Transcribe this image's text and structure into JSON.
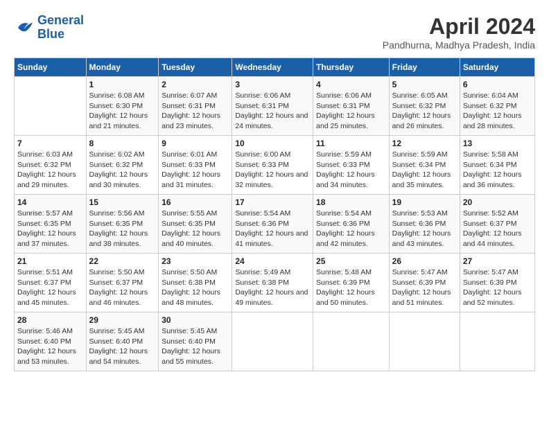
{
  "logo": {
    "line1": "General",
    "line2": "Blue"
  },
  "title": "April 2024",
  "location": "Pandhurna, Madhya Pradesh, India",
  "days_header": [
    "Sunday",
    "Monday",
    "Tuesday",
    "Wednesday",
    "Thursday",
    "Friday",
    "Saturday"
  ],
  "weeks": [
    [
      {
        "day": "",
        "sunrise": "",
        "sunset": "",
        "daylight": ""
      },
      {
        "day": "1",
        "sunrise": "6:08 AM",
        "sunset": "6:30 PM",
        "daylight": "12 hours and 21 minutes."
      },
      {
        "day": "2",
        "sunrise": "6:07 AM",
        "sunset": "6:31 PM",
        "daylight": "12 hours and 23 minutes."
      },
      {
        "day": "3",
        "sunrise": "6:06 AM",
        "sunset": "6:31 PM",
        "daylight": "12 hours and 24 minutes."
      },
      {
        "day": "4",
        "sunrise": "6:06 AM",
        "sunset": "6:31 PM",
        "daylight": "12 hours and 25 minutes."
      },
      {
        "day": "5",
        "sunrise": "6:05 AM",
        "sunset": "6:32 PM",
        "daylight": "12 hours and 26 minutes."
      },
      {
        "day": "6",
        "sunrise": "6:04 AM",
        "sunset": "6:32 PM",
        "daylight": "12 hours and 28 minutes."
      }
    ],
    [
      {
        "day": "7",
        "sunrise": "6:03 AM",
        "sunset": "6:32 PM",
        "daylight": "12 hours and 29 minutes."
      },
      {
        "day": "8",
        "sunrise": "6:02 AM",
        "sunset": "6:32 PM",
        "daylight": "12 hours and 30 minutes."
      },
      {
        "day": "9",
        "sunrise": "6:01 AM",
        "sunset": "6:33 PM",
        "daylight": "12 hours and 31 minutes."
      },
      {
        "day": "10",
        "sunrise": "6:00 AM",
        "sunset": "6:33 PM",
        "daylight": "12 hours and 32 minutes."
      },
      {
        "day": "11",
        "sunrise": "5:59 AM",
        "sunset": "6:33 PM",
        "daylight": "12 hours and 34 minutes."
      },
      {
        "day": "12",
        "sunrise": "5:59 AM",
        "sunset": "6:34 PM",
        "daylight": "12 hours and 35 minutes."
      },
      {
        "day": "13",
        "sunrise": "5:58 AM",
        "sunset": "6:34 PM",
        "daylight": "12 hours and 36 minutes."
      }
    ],
    [
      {
        "day": "14",
        "sunrise": "5:57 AM",
        "sunset": "6:35 PM",
        "daylight": "12 hours and 37 minutes."
      },
      {
        "day": "15",
        "sunrise": "5:56 AM",
        "sunset": "6:35 PM",
        "daylight": "12 hours and 38 minutes."
      },
      {
        "day": "16",
        "sunrise": "5:55 AM",
        "sunset": "6:35 PM",
        "daylight": "12 hours and 40 minutes."
      },
      {
        "day": "17",
        "sunrise": "5:54 AM",
        "sunset": "6:36 PM",
        "daylight": "12 hours and 41 minutes."
      },
      {
        "day": "18",
        "sunrise": "5:54 AM",
        "sunset": "6:36 PM",
        "daylight": "12 hours and 42 minutes."
      },
      {
        "day": "19",
        "sunrise": "5:53 AM",
        "sunset": "6:36 PM",
        "daylight": "12 hours and 43 minutes."
      },
      {
        "day": "20",
        "sunrise": "5:52 AM",
        "sunset": "6:37 PM",
        "daylight": "12 hours and 44 minutes."
      }
    ],
    [
      {
        "day": "21",
        "sunrise": "5:51 AM",
        "sunset": "6:37 PM",
        "daylight": "12 hours and 45 minutes."
      },
      {
        "day": "22",
        "sunrise": "5:50 AM",
        "sunset": "6:37 PM",
        "daylight": "12 hours and 46 minutes."
      },
      {
        "day": "23",
        "sunrise": "5:50 AM",
        "sunset": "6:38 PM",
        "daylight": "12 hours and 48 minutes."
      },
      {
        "day": "24",
        "sunrise": "5:49 AM",
        "sunset": "6:38 PM",
        "daylight": "12 hours and 49 minutes."
      },
      {
        "day": "25",
        "sunrise": "5:48 AM",
        "sunset": "6:39 PM",
        "daylight": "12 hours and 50 minutes."
      },
      {
        "day": "26",
        "sunrise": "5:47 AM",
        "sunset": "6:39 PM",
        "daylight": "12 hours and 51 minutes."
      },
      {
        "day": "27",
        "sunrise": "5:47 AM",
        "sunset": "6:39 PM",
        "daylight": "12 hours and 52 minutes."
      }
    ],
    [
      {
        "day": "28",
        "sunrise": "5:46 AM",
        "sunset": "6:40 PM",
        "daylight": "12 hours and 53 minutes."
      },
      {
        "day": "29",
        "sunrise": "5:45 AM",
        "sunset": "6:40 PM",
        "daylight": "12 hours and 54 minutes."
      },
      {
        "day": "30",
        "sunrise": "5:45 AM",
        "sunset": "6:40 PM",
        "daylight": "12 hours and 55 minutes."
      },
      {
        "day": "",
        "sunrise": "",
        "sunset": "",
        "daylight": ""
      },
      {
        "day": "",
        "sunrise": "",
        "sunset": "",
        "daylight": ""
      },
      {
        "day": "",
        "sunrise": "",
        "sunset": "",
        "daylight": ""
      },
      {
        "day": "",
        "sunrise": "",
        "sunset": "",
        "daylight": ""
      }
    ]
  ]
}
